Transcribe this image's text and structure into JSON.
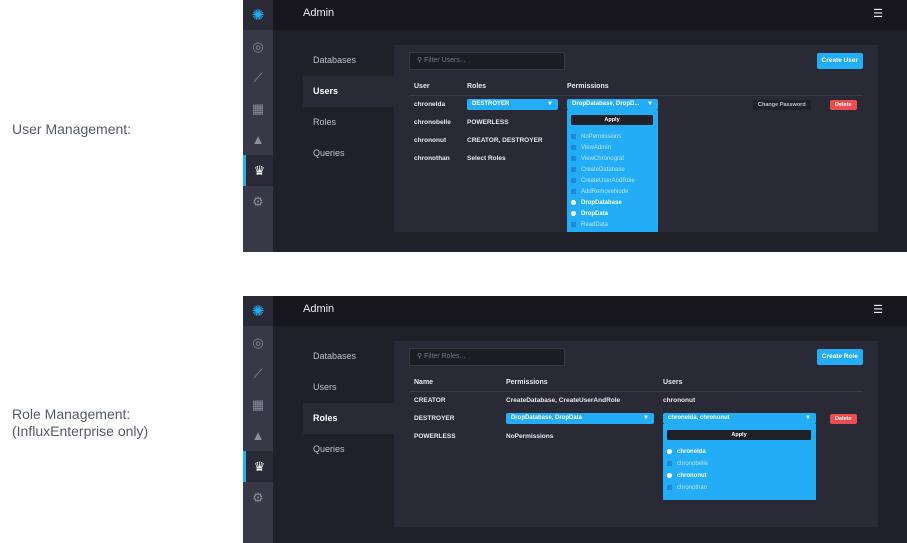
{
  "captions": {
    "users": "User Management:",
    "roles_line1": "Role Management:",
    "roles_line2": "(InfluxEnterprise only)"
  },
  "colors": {
    "accent": "#22adf6",
    "danger": "#ef4d4d",
    "bg": "#202028",
    "panel": "#2a2a36"
  },
  "sidenav_icons": [
    "logo-icon",
    "dashboard-icon",
    "graph-icon",
    "hosts-icon",
    "alert-icon",
    "admin-crown-icon",
    "settings-gear-icon"
  ],
  "top": {
    "title": "Admin",
    "subnav": [
      "Databases",
      "Users",
      "Roles",
      "Queries"
    ],
    "filter_placeholder": "Filter Users...",
    "create_button": "Create User",
    "headers": {
      "user": "User",
      "roles": "Roles",
      "permissions": "Permissions"
    },
    "rows": [
      {
        "user": "chronelda",
        "roles": "DESTROYER",
        "permissions": "DropDatabase, DropD..."
      },
      {
        "user": "chronobelle",
        "roles": "POWERLESS"
      },
      {
        "user": "chrononut",
        "roles": "CREATOR, DESTROYER"
      },
      {
        "user": "chronothan",
        "roles": "Select Roles"
      }
    ],
    "change_password": "Change Password",
    "delete": "Delete",
    "apply": "Apply",
    "permission_options": [
      {
        "label": "NoPermissions",
        "selected": false
      },
      {
        "label": "ViewAdmin",
        "selected": false
      },
      {
        "label": "ViewChronograf",
        "selected": false
      },
      {
        "label": "CreateDatabase",
        "selected": false
      },
      {
        "label": "CreateUserAndRole",
        "selected": false
      },
      {
        "label": "AddRemoveNode",
        "selected": false
      },
      {
        "label": "DropDatabase",
        "selected": true
      },
      {
        "label": "DropData",
        "selected": true
      },
      {
        "label": "ReadData",
        "selected": false
      }
    ]
  },
  "bottom": {
    "title": "Admin",
    "subnav": [
      "Databases",
      "Users",
      "Roles",
      "Queries"
    ],
    "filter_placeholder": "Filter Roles...",
    "create_button": "Create Role",
    "headers": {
      "name": "Name",
      "permissions": "Permissions",
      "users": "Users"
    },
    "rows": [
      {
        "name": "CREATOR",
        "permissions": "CreateDatabase, CreateUserAndRole",
        "users": "chrononut"
      },
      {
        "name": "DESTROYER",
        "permissions": "DropDatabase, DropData",
        "users": "chronelda, chrononut"
      },
      {
        "name": "POWERLESS",
        "permissions": "NoPermissions",
        "users": ""
      }
    ],
    "delete": "Delete",
    "apply": "Apply",
    "user_options": [
      {
        "label": "chronelda",
        "selected": true
      },
      {
        "label": "chronobelle",
        "selected": false
      },
      {
        "label": "chrononut",
        "selected": true
      },
      {
        "label": "chronothan",
        "selected": false
      }
    ]
  }
}
